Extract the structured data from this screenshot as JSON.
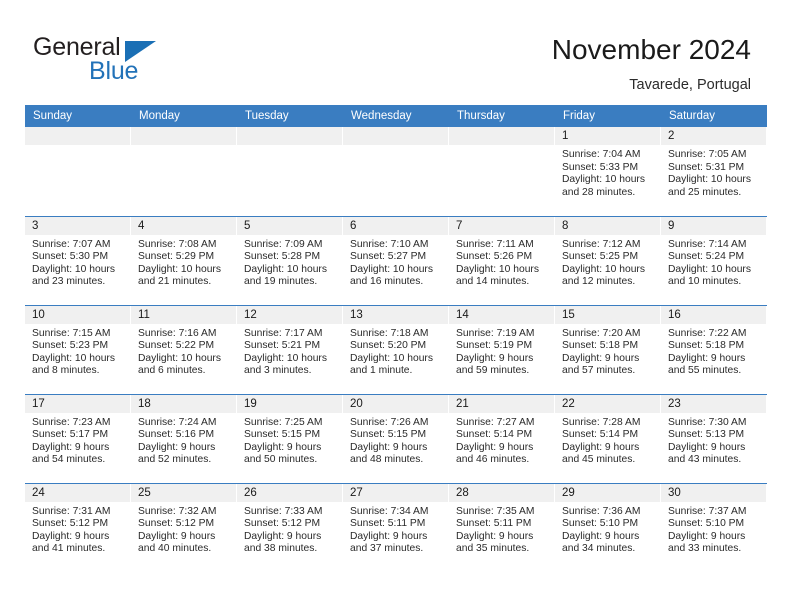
{
  "brand": {
    "name_top": "General",
    "name_bottom": "Blue",
    "accent_color": "#2272b8",
    "triangle_color": "#1a6fb5"
  },
  "header": {
    "title": "November 2024",
    "subtitle": "Tavarede, Portugal"
  },
  "calendar": {
    "header_bg": "#3a7dc1",
    "daynum_bg": "#f0f0f0",
    "weekday_labels": [
      "Sunday",
      "Monday",
      "Tuesday",
      "Wednesday",
      "Thursday",
      "Friday",
      "Saturday"
    ],
    "weeks": [
      [
        {
          "day": "",
          "empty": true
        },
        {
          "day": "",
          "empty": true
        },
        {
          "day": "",
          "empty": true
        },
        {
          "day": "",
          "empty": true
        },
        {
          "day": "",
          "empty": true
        },
        {
          "day": "1",
          "sunrise": "Sunrise: 7:04 AM",
          "sunset": "Sunset: 5:33 PM",
          "daylight": "Daylight: 10 hours and 28 minutes."
        },
        {
          "day": "2",
          "sunrise": "Sunrise: 7:05 AM",
          "sunset": "Sunset: 5:31 PM",
          "daylight": "Daylight: 10 hours and 25 minutes."
        }
      ],
      [
        {
          "day": "3",
          "sunrise": "Sunrise: 7:07 AM",
          "sunset": "Sunset: 5:30 PM",
          "daylight": "Daylight: 10 hours and 23 minutes."
        },
        {
          "day": "4",
          "sunrise": "Sunrise: 7:08 AM",
          "sunset": "Sunset: 5:29 PM",
          "daylight": "Daylight: 10 hours and 21 minutes."
        },
        {
          "day": "5",
          "sunrise": "Sunrise: 7:09 AM",
          "sunset": "Sunset: 5:28 PM",
          "daylight": "Daylight: 10 hours and 19 minutes."
        },
        {
          "day": "6",
          "sunrise": "Sunrise: 7:10 AM",
          "sunset": "Sunset: 5:27 PM",
          "daylight": "Daylight: 10 hours and 16 minutes."
        },
        {
          "day": "7",
          "sunrise": "Sunrise: 7:11 AM",
          "sunset": "Sunset: 5:26 PM",
          "daylight": "Daylight: 10 hours and 14 minutes."
        },
        {
          "day": "8",
          "sunrise": "Sunrise: 7:12 AM",
          "sunset": "Sunset: 5:25 PM",
          "daylight": "Daylight: 10 hours and 12 minutes."
        },
        {
          "day": "9",
          "sunrise": "Sunrise: 7:14 AM",
          "sunset": "Sunset: 5:24 PM",
          "daylight": "Daylight: 10 hours and 10 minutes."
        }
      ],
      [
        {
          "day": "10",
          "sunrise": "Sunrise: 7:15 AM",
          "sunset": "Sunset: 5:23 PM",
          "daylight": "Daylight: 10 hours and 8 minutes."
        },
        {
          "day": "11",
          "sunrise": "Sunrise: 7:16 AM",
          "sunset": "Sunset: 5:22 PM",
          "daylight": "Daylight: 10 hours and 6 minutes."
        },
        {
          "day": "12",
          "sunrise": "Sunrise: 7:17 AM",
          "sunset": "Sunset: 5:21 PM",
          "daylight": "Daylight: 10 hours and 3 minutes."
        },
        {
          "day": "13",
          "sunrise": "Sunrise: 7:18 AM",
          "sunset": "Sunset: 5:20 PM",
          "daylight": "Daylight: 10 hours and 1 minute."
        },
        {
          "day": "14",
          "sunrise": "Sunrise: 7:19 AM",
          "sunset": "Sunset: 5:19 PM",
          "daylight": "Daylight: 9 hours and 59 minutes."
        },
        {
          "day": "15",
          "sunrise": "Sunrise: 7:20 AM",
          "sunset": "Sunset: 5:18 PM",
          "daylight": "Daylight: 9 hours and 57 minutes."
        },
        {
          "day": "16",
          "sunrise": "Sunrise: 7:22 AM",
          "sunset": "Sunset: 5:18 PM",
          "daylight": "Daylight: 9 hours and 55 minutes."
        }
      ],
      [
        {
          "day": "17",
          "sunrise": "Sunrise: 7:23 AM",
          "sunset": "Sunset: 5:17 PM",
          "daylight": "Daylight: 9 hours and 54 minutes."
        },
        {
          "day": "18",
          "sunrise": "Sunrise: 7:24 AM",
          "sunset": "Sunset: 5:16 PM",
          "daylight": "Daylight: 9 hours and 52 minutes."
        },
        {
          "day": "19",
          "sunrise": "Sunrise: 7:25 AM",
          "sunset": "Sunset: 5:15 PM",
          "daylight": "Daylight: 9 hours and 50 minutes."
        },
        {
          "day": "20",
          "sunrise": "Sunrise: 7:26 AM",
          "sunset": "Sunset: 5:15 PM",
          "daylight": "Daylight: 9 hours and 48 minutes."
        },
        {
          "day": "21",
          "sunrise": "Sunrise: 7:27 AM",
          "sunset": "Sunset: 5:14 PM",
          "daylight": "Daylight: 9 hours and 46 minutes."
        },
        {
          "day": "22",
          "sunrise": "Sunrise: 7:28 AM",
          "sunset": "Sunset: 5:14 PM",
          "daylight": "Daylight: 9 hours and 45 minutes."
        },
        {
          "day": "23",
          "sunrise": "Sunrise: 7:30 AM",
          "sunset": "Sunset: 5:13 PM",
          "daylight": "Daylight: 9 hours and 43 minutes."
        }
      ],
      [
        {
          "day": "24",
          "sunrise": "Sunrise: 7:31 AM",
          "sunset": "Sunset: 5:12 PM",
          "daylight": "Daylight: 9 hours and 41 minutes."
        },
        {
          "day": "25",
          "sunrise": "Sunrise: 7:32 AM",
          "sunset": "Sunset: 5:12 PM",
          "daylight": "Daylight: 9 hours and 40 minutes."
        },
        {
          "day": "26",
          "sunrise": "Sunrise: 7:33 AM",
          "sunset": "Sunset: 5:12 PM",
          "daylight": "Daylight: 9 hours and 38 minutes."
        },
        {
          "day": "27",
          "sunrise": "Sunrise: 7:34 AM",
          "sunset": "Sunset: 5:11 PM",
          "daylight": "Daylight: 9 hours and 37 minutes."
        },
        {
          "day": "28",
          "sunrise": "Sunrise: 7:35 AM",
          "sunset": "Sunset: 5:11 PM",
          "daylight": "Daylight: 9 hours and 35 minutes."
        },
        {
          "day": "29",
          "sunrise": "Sunrise: 7:36 AM",
          "sunset": "Sunset: 5:10 PM",
          "daylight": "Daylight: 9 hours and 34 minutes."
        },
        {
          "day": "30",
          "sunrise": "Sunrise: 7:37 AM",
          "sunset": "Sunset: 5:10 PM",
          "daylight": "Daylight: 9 hours and 33 minutes."
        }
      ]
    ]
  }
}
